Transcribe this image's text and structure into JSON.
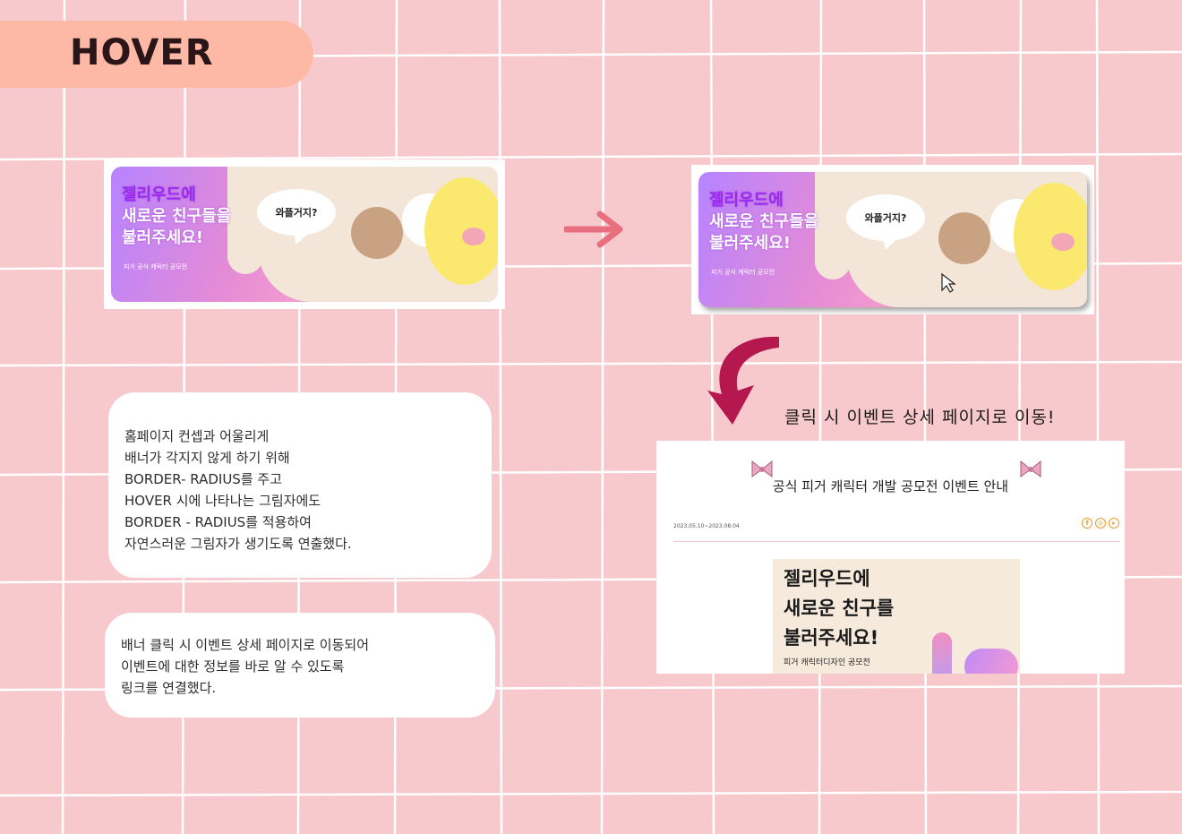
{
  "section_title": "HOVER",
  "banner": {
    "headline_line1": "젤리우드에",
    "headline_line2": "새로운 친구들을",
    "headline_line3": "불러주세요!",
    "subline": "피거 공식 캐릭터 공모전",
    "speech": "와플거지?"
  },
  "notes": [
    {
      "lines": [
        "홈페이지 컨셉과 어울리게",
        "배너가 각지지 않게 하기 위해",
        "BORDER- RADIUS를 주고",
        "HOVER 시에 나타나는 그림자에도",
        "BORDER - RADIUS를 적용하여",
        "자연스러운 그림자가 생기도록 연출했다."
      ]
    },
    {
      "lines": [
        "배너 클릭 시 이벤트 상세 페이지로 이동되어",
        "이벤트에 대한 정보를 바로 알 수 있도록",
        "링크를 연결했다."
      ]
    }
  ],
  "click_caption": "클릭 시 이벤트 상세 페이지로 이동!",
  "detail_page": {
    "title": "공식 피거 캐릭터 개발 공모전 이벤트 안내",
    "date_range": "2023.05.10~2023.08.04",
    "social_icons": [
      "facebook-icon",
      "instagram-icon",
      "youtube-icon"
    ],
    "poster_line1": "젤리우드에",
    "poster_line2": "새로운 친구를",
    "poster_line3": "불러주세요!",
    "poster_sub": "피거 캐릭터디자인 공모전"
  },
  "colors": {
    "background": "#f7c9cd",
    "title_pill": "#fdb9a5",
    "arrow_pink": "#e8707e",
    "curved_arrow": "#b5174f"
  }
}
